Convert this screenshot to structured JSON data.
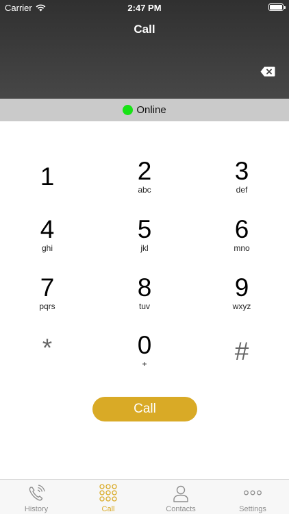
{
  "status_bar": {
    "carrier": "Carrier",
    "time": "2:47 PM"
  },
  "nav": {
    "title": "Call"
  },
  "dial_input": {
    "value": "",
    "placeholder": ""
  },
  "connection": {
    "status": "Online",
    "status_color": "#18e316"
  },
  "dialpad": {
    "keys": [
      {
        "digit": "1",
        "letters": ""
      },
      {
        "digit": "2",
        "letters": "abc"
      },
      {
        "digit": "3",
        "letters": "def"
      },
      {
        "digit": "4",
        "letters": "ghi"
      },
      {
        "digit": "5",
        "letters": "jkl"
      },
      {
        "digit": "6",
        "letters": "mno"
      },
      {
        "digit": "7",
        "letters": "pqrs"
      },
      {
        "digit": "8",
        "letters": "tuv"
      },
      {
        "digit": "9",
        "letters": "wxyz"
      },
      {
        "digit": "*",
        "letters": ""
      },
      {
        "digit": "0",
        "letters": "+"
      },
      {
        "digit": "#",
        "letters": ""
      }
    ]
  },
  "call_button": {
    "label": "Call",
    "color": "#d9aa26"
  },
  "tabbar": {
    "tabs": [
      {
        "label": "History",
        "icon": "phone-history-icon"
      },
      {
        "label": "Call",
        "icon": "dialpad-icon"
      },
      {
        "label": "Contacts",
        "icon": "person-icon"
      },
      {
        "label": "Settings",
        "icon": "more-icon"
      }
    ],
    "active_index": 1,
    "active_color": "#d9aa26"
  }
}
